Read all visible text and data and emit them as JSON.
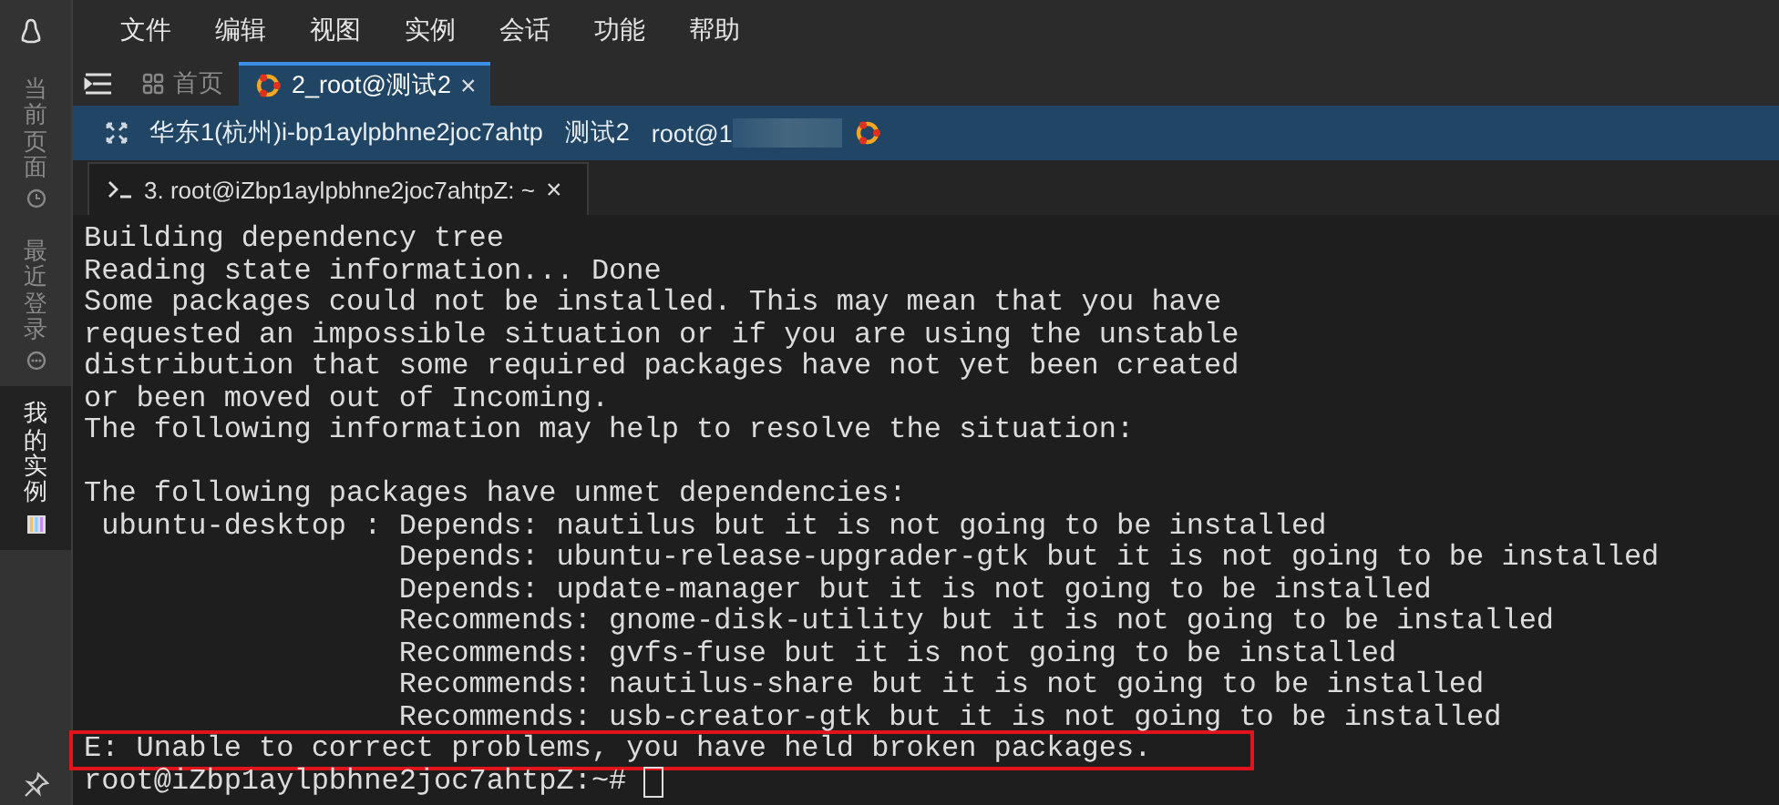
{
  "menu": [
    "文件",
    "编辑",
    "视图",
    "实例",
    "会话",
    "功能",
    "帮助"
  ],
  "sidebar": {
    "items": [
      {
        "label": "当前页面",
        "kind": "current",
        "selected": false
      },
      {
        "label": "最近登录",
        "kind": "recent",
        "selected": false
      },
      {
        "label": "我的实例",
        "kind": "instances",
        "selected": true
      }
    ]
  },
  "session_tabs": [
    {
      "label": "首页",
      "kind": "home",
      "selected": false
    },
    {
      "label": "2_root@测试2",
      "kind": "session",
      "selected": true,
      "close": "×"
    }
  ],
  "info_bar": [
    "华东1(杭州)i-bp1aylpbhne2joc7ahtp",
    "测试2",
    "root@1"
  ],
  "terminal_tabs": [
    {
      "label": "3. root@iZbp1aylpbhne2joc7ahtpZ: ~",
      "selected": true,
      "close": "×"
    }
  ],
  "terminal": {
    "lines": [
      {
        "text": "Building dependency tree",
        "highlighted": false
      },
      {
        "text": "Reading state information... Done",
        "highlighted": false
      },
      {
        "text": "Some packages could not be installed. This may mean that you have",
        "highlighted": false
      },
      {
        "text": "requested an impossible situation or if you are using the unstable",
        "highlighted": false
      },
      {
        "text": "distribution that some required packages have not yet been created",
        "highlighted": false
      },
      {
        "text": "or been moved out of Incoming.",
        "highlighted": false
      },
      {
        "text": "The following information may help to resolve the situation:",
        "highlighted": false
      },
      {
        "highlighted": false
      },
      {
        "text": "The following packages have unmet dependencies:",
        "highlighted": false
      },
      {
        "text": " ubuntu-desktop : Depends: nautilus but it is not going to be installed",
        "highlighted": false
      },
      {
        "text": "                  Depends: ubuntu-release-upgrader-gtk but it is not going to be installed",
        "highlighted": false
      },
      {
        "text": "                  Depends: update-manager but it is not going to be installed",
        "highlighted": false
      },
      {
        "text": "                  Recommends: gnome-disk-utility but it is not going to be installed",
        "highlighted": false
      },
      {
        "text": "                  Recommends: gvfs-fuse but it is not going to be installed",
        "highlighted": false
      },
      {
        "text": "                  Recommends: nautilus-share but it is not going to be installed",
        "highlighted": false
      },
      {
        "text": "                  Recommends: usb-creator-gtk but it is not going to be installed",
        "highlighted": false
      },
      {
        "text": "E: Unable to correct problems, you have held broken packages.",
        "highlighted": true
      }
    ],
    "prompt": "root@iZbp1aylpbhne2joc7ahtpZ:~#"
  }
}
